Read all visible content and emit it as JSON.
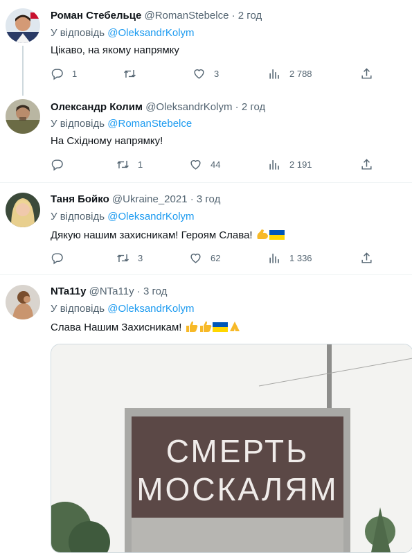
{
  "colors": {
    "link": "#1d9bf0",
    "muted": "#536471",
    "text": "#0f1419",
    "ukraine_blue": "#0057b7",
    "ukraine_yellow": "#ffd700"
  },
  "tweets": [
    {
      "name": "Роман Стебельце",
      "handle": "@RomanStebelce",
      "sep": "·",
      "time": "2 год",
      "reply_prefix": "У відповідь",
      "reply_to": "@OleksandrKolym",
      "text": "Цікаво, на якому напрямку",
      "replies": "1",
      "retweets": "",
      "likes": "3",
      "views": "2 788"
    },
    {
      "name": "Олександр Колим",
      "handle": "@OleksandrKolym",
      "sep": "·",
      "time": "2 год",
      "reply_prefix": "У відповідь",
      "reply_to": "@RomanStebelce",
      "text": "На Східному напрямку!",
      "replies": "",
      "retweets": "1",
      "likes": "44",
      "views": "2 191"
    },
    {
      "name": "Таня Бойко",
      "handle": "@Ukraine_2021",
      "sep": "·",
      "time": "3 год",
      "reply_prefix": "У відповідь",
      "reply_to": "@OleksandrKolym",
      "text": "Дякую нашим захисникам! Героям Слава!",
      "replies": "",
      "retweets": "3",
      "likes": "62",
      "views": "1 336"
    },
    {
      "name": "NTa11y",
      "handle": "@NTa11y",
      "sep": "·",
      "time": "3 год",
      "reply_prefix": "У відповідь",
      "reply_to": "@OleksandrKolym",
      "text": "Слава Нашим Захисникам!"
    }
  ],
  "media": {
    "sign_line1": "СМЕРТЬ",
    "sign_line2": "МОСКАЛЯМ"
  },
  "icons": [
    "reply-icon",
    "retweet-icon",
    "like-icon",
    "views-icon",
    "share-icon",
    "flexed-biceps-emoji",
    "ukraine-flag-emoji",
    "thumbs-up-emoji",
    "folded-hands-emoji"
  ]
}
